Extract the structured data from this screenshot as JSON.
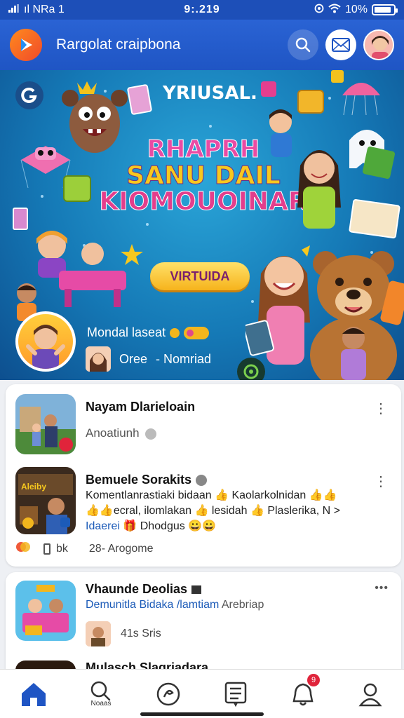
{
  "status_bar": {
    "carrier": "ıl NRa 1",
    "time": "9:.219",
    "battery_text": "10%",
    "battery_level": 0.9
  },
  "header": {
    "title": "Rargolat craipbona"
  },
  "banner": {
    "brand": "YRIUSAL.",
    "headline": [
      "RHAPRH",
      "SANU DAIL",
      "KIOMOUOINAR"
    ],
    "cta_label": "VIRTUIDA",
    "featured_name": "Mondal laseat",
    "featured_meta_left": "Oree",
    "featured_meta_right": "- Nomriad"
  },
  "feed": {
    "post1": {
      "title": "Nayam Dlarieloain",
      "subtitle": "Anoatiunh"
    },
    "post2": {
      "title": "Bemuele Sorakits",
      "line1": "Komentlanrastiaki bidaan 👍 Kaolarkolnidan 👍👍",
      "line2": "👍👍ecral, ilomlakan 👍 lesidah 👍 Plaslerika, N >",
      "line3_hl": "Idaerei 🎁",
      "line3": " Dhodgus 😀😀",
      "reaction_count": "bk",
      "time_text": "28- Arogome"
    },
    "post3": {
      "title": "Vhaunde Deolias",
      "subtitle_hl": "Demunitla Bidaka /lamtiam",
      "subtitle_tail": " Arebriap",
      "meta": "41s Sris"
    },
    "post4": {
      "title": "Mulasch Slagriadara"
    }
  },
  "bottom_nav": {
    "search_label": "Noaas",
    "notification_count": "9"
  },
  "colors": {
    "primary": "#1f55c4",
    "accent": "#f6b31c",
    "badge": "#e0243b"
  }
}
